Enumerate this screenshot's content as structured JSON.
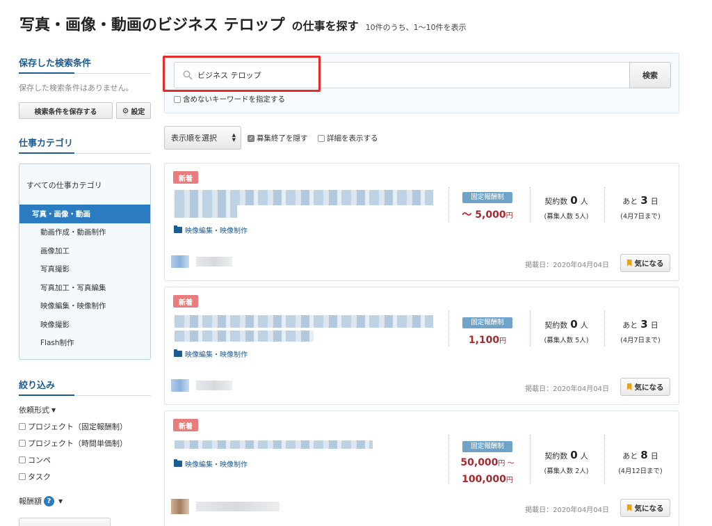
{
  "header": {
    "title": "写真・画像・動画のビジネス テロップ",
    "suffix": "の仕事を探す",
    "count": "10件のうち、1〜10件を表示"
  },
  "sidebar": {
    "saved_heading": "保存した検索条件",
    "saved_note": "保存した検索条件はありません。",
    "save_button": "検索条件を保存する",
    "settings_button": "設定",
    "category_heading": "仕事カテゴリ",
    "category_all": "すべての仕事カテゴリ",
    "category_active": "写真・画像・動画",
    "subcategories": [
      "動画作成・動画制作",
      "画像加工",
      "写真撮影",
      "写真加工・写真編集",
      "映像編集・映像制作",
      "映像撮影",
      "Flash制作"
    ],
    "filter_heading": "絞り込み",
    "request_type_label": "依頼形式",
    "request_types": [
      "プロジェクト（固定報酬制）",
      "プロジェクト（時間単価制）",
      "コンペ",
      "タスク"
    ],
    "reward_label": "報酬額"
  },
  "search": {
    "value": "ビジネス テロップ",
    "button": "検索",
    "exclude_label": "含めないキーワードを指定する"
  },
  "sort": {
    "selected": "表示順を選択",
    "hide_closed": "募集終了を隠す",
    "hide_closed_checked": true,
    "show_details": "詳細を表示する",
    "show_details_checked": false
  },
  "jobs": [
    {
      "badge": "新着",
      "category": "映像編集・映像制作",
      "price_type": "固定報酬制",
      "price_line1": "〜 5,000",
      "price_line2": "",
      "yen": "円",
      "contract_label": "契約数",
      "contract_count": "0",
      "contract_unit": "人",
      "recruit": "(募集人数 5人)",
      "remain_label": "あと",
      "remain_days": "3",
      "remain_unit": "日",
      "deadline": "(4月7日まで)",
      "posted": "掲載日：2020年04月04日",
      "fav": "気になる"
    },
    {
      "badge": "新着",
      "category": "映像編集・映像制作",
      "price_type": "固定報酬制",
      "price_line1": "1,100",
      "price_line2": "",
      "yen": "円",
      "contract_label": "契約数",
      "contract_count": "0",
      "contract_unit": "人",
      "recruit": "(募集人数 5人)",
      "remain_label": "あと",
      "remain_days": "3",
      "remain_unit": "日",
      "deadline": "(4月7日まで)",
      "posted": "掲載日：2020年04月04日",
      "fav": "気になる"
    },
    {
      "badge": "新着",
      "category": "映像編集・映像制作",
      "price_type": "固定報酬制",
      "price_line1": "50,000",
      "price_line1_suffix": "円 〜",
      "price_line2": "100,000",
      "yen": "円",
      "contract_label": "契約数",
      "contract_count": "0",
      "contract_unit": "人",
      "recruit": "(募集人数 2人)",
      "remain_label": "あと",
      "remain_days": "8",
      "remain_unit": "日",
      "deadline": "(4月12日まで)",
      "posted": "掲載日：2020年04月04日",
      "fav": "気になる"
    }
  ],
  "colors": {
    "accent": "#1d5c91",
    "active_category": "#2a7bc0",
    "price": "#a8272c",
    "badge_new": "#e87d7d",
    "highlight": "#e52b2b"
  }
}
